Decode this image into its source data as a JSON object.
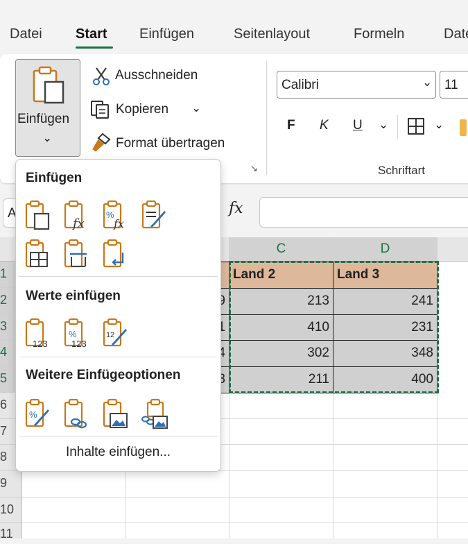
{
  "tabs": [
    {
      "label": "Datei",
      "active": false
    },
    {
      "label": "Start",
      "active": true
    },
    {
      "label": "Einfügen",
      "active": false
    },
    {
      "label": "Seitenlayout",
      "active": false
    },
    {
      "label": "Formeln",
      "active": false
    },
    {
      "label": "Daten",
      "active": false
    }
  ],
  "clipboard": {
    "paste_label": "Einfügen",
    "paste_caret": "⌄",
    "cut_label": "Ausschneiden",
    "copy_label": "Kopieren",
    "copy_caret": "⌄",
    "format_painter_label": "Format übertragen",
    "launcher": "↘"
  },
  "font": {
    "name": "Calibri",
    "size": "11",
    "bold": "F",
    "italic": "K",
    "underline": "U",
    "caret": "⌄",
    "group_label": "Schriftart"
  },
  "formula_bar": {
    "name_box": "A",
    "fx": "fx",
    "value": ""
  },
  "grid": {
    "columns": [
      "C",
      "D"
    ],
    "rows": [
      "1",
      "2",
      "3",
      "4",
      "5",
      "6",
      "7",
      "8",
      "9",
      "10",
      "11"
    ],
    "selected_rows": [
      "1",
      "2",
      "3",
      "4",
      "5"
    ],
    "header_cells": [
      "Land 2",
      "Land 3"
    ],
    "b_partial": [
      "9",
      "1",
      "4",
      "3"
    ],
    "data": [
      [
        "213",
        "241"
      ],
      [
        "410",
        "231"
      ],
      [
        "302",
        "348"
      ],
      [
        "211",
        "400"
      ]
    ]
  },
  "paste_menu": {
    "section1": "Einfügen",
    "section2": "Werte einfügen",
    "section3": "Weitere Einfügeoptionen",
    "special": "Inhalte einfügen..."
  },
  "colors": {
    "accent": "#1e7145",
    "header_fill": "#deb89b",
    "data_fill": "#d0d0d0",
    "icon_orange": "#c9781a",
    "icon_blue": "#2f6fb7"
  }
}
